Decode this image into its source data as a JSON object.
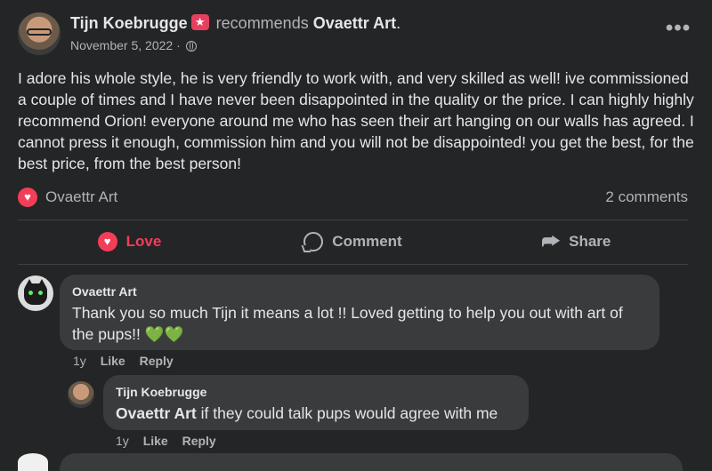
{
  "post": {
    "author": "Tijn Koebrugge",
    "action_text": "recommends",
    "page": "Ovaettr Art",
    "period": ".",
    "date": "November 5, 2022",
    "date_sep": " · ",
    "body": "I adore his whole style, he is very friendly to work with, and very skilled as well! ive commissioned a couple of times and I have never been disappointed in the quality or the price. I can highly highly recommend Orion! everyone around me who has seen their art hanging on our walls has agreed. I cannot press it enough, commission him and you will not be disappointed! you get the best, for the best price, from the best person!",
    "reaction_page": "Ovaettr Art",
    "comments_count": "2 comments",
    "more_glyph": "•••"
  },
  "actions": {
    "love": "Love",
    "comment": "Comment",
    "share": "Share",
    "heart_glyph": "♥",
    "share_glyph": "⮫"
  },
  "comments": [
    {
      "author": "Ovaettr Art",
      "text": "Thank you so much Tijn it means a lot !! Loved getting to help you out with art of the pups!! ",
      "emoji": "💚💚",
      "age": "1y",
      "like": "Like",
      "reply": "Reply"
    },
    {
      "author": "Tijn Koebrugge",
      "mention": "Ovaettr Art",
      "text": " if they could talk pups would agree with me",
      "age": "1y",
      "like": "Like",
      "reply": "Reply"
    }
  ],
  "colors": {
    "background": "#242526",
    "bubble": "#3a3b3c",
    "love": "#f33e58",
    "secondary_text": "#b0b3b8"
  }
}
